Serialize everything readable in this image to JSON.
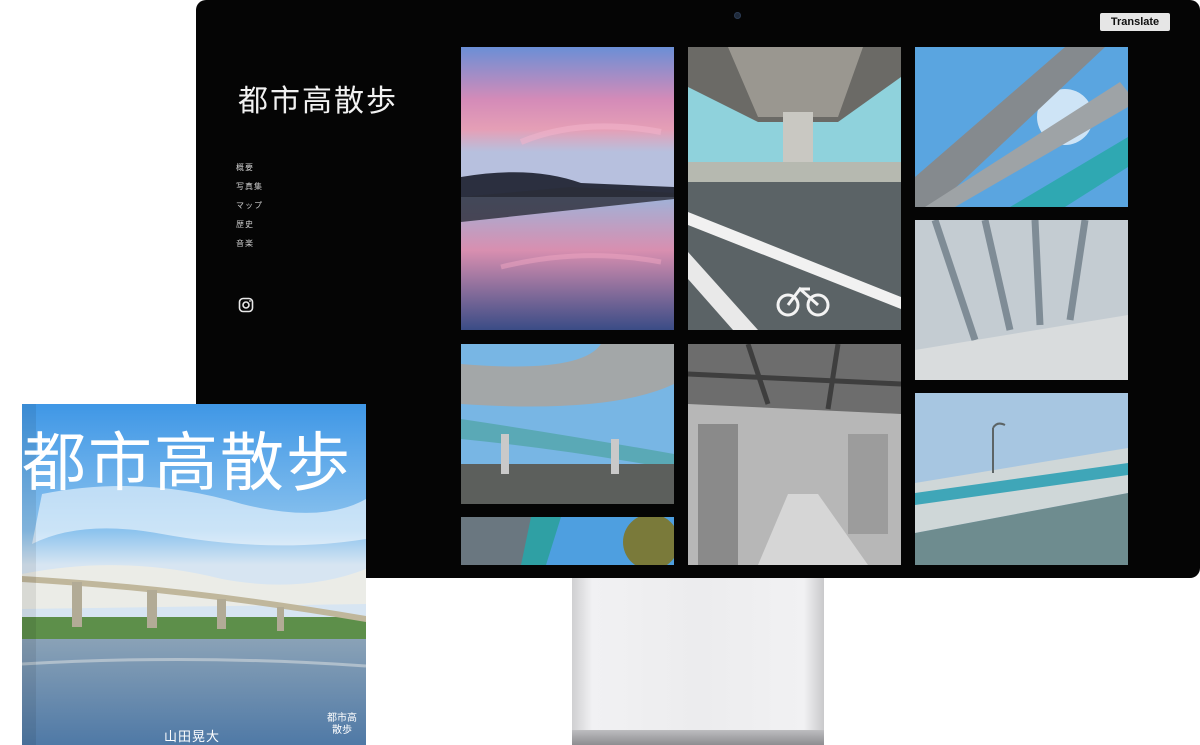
{
  "site": {
    "title": "都市高散歩",
    "translate_label": "Translate",
    "nav": [
      "概要",
      "写真集",
      "マップ",
      "歴史",
      "音楽"
    ]
  },
  "book": {
    "title": "都市高散歩",
    "author": "山田晃大",
    "badge_line1": "都市高",
    "badge_line2": "散歩"
  },
  "colors": {
    "background": "#050505",
    "nav_text": "#cfcfcf",
    "button_bg": "#e6e6e6"
  },
  "icons": {
    "social": "instagram-icon"
  }
}
